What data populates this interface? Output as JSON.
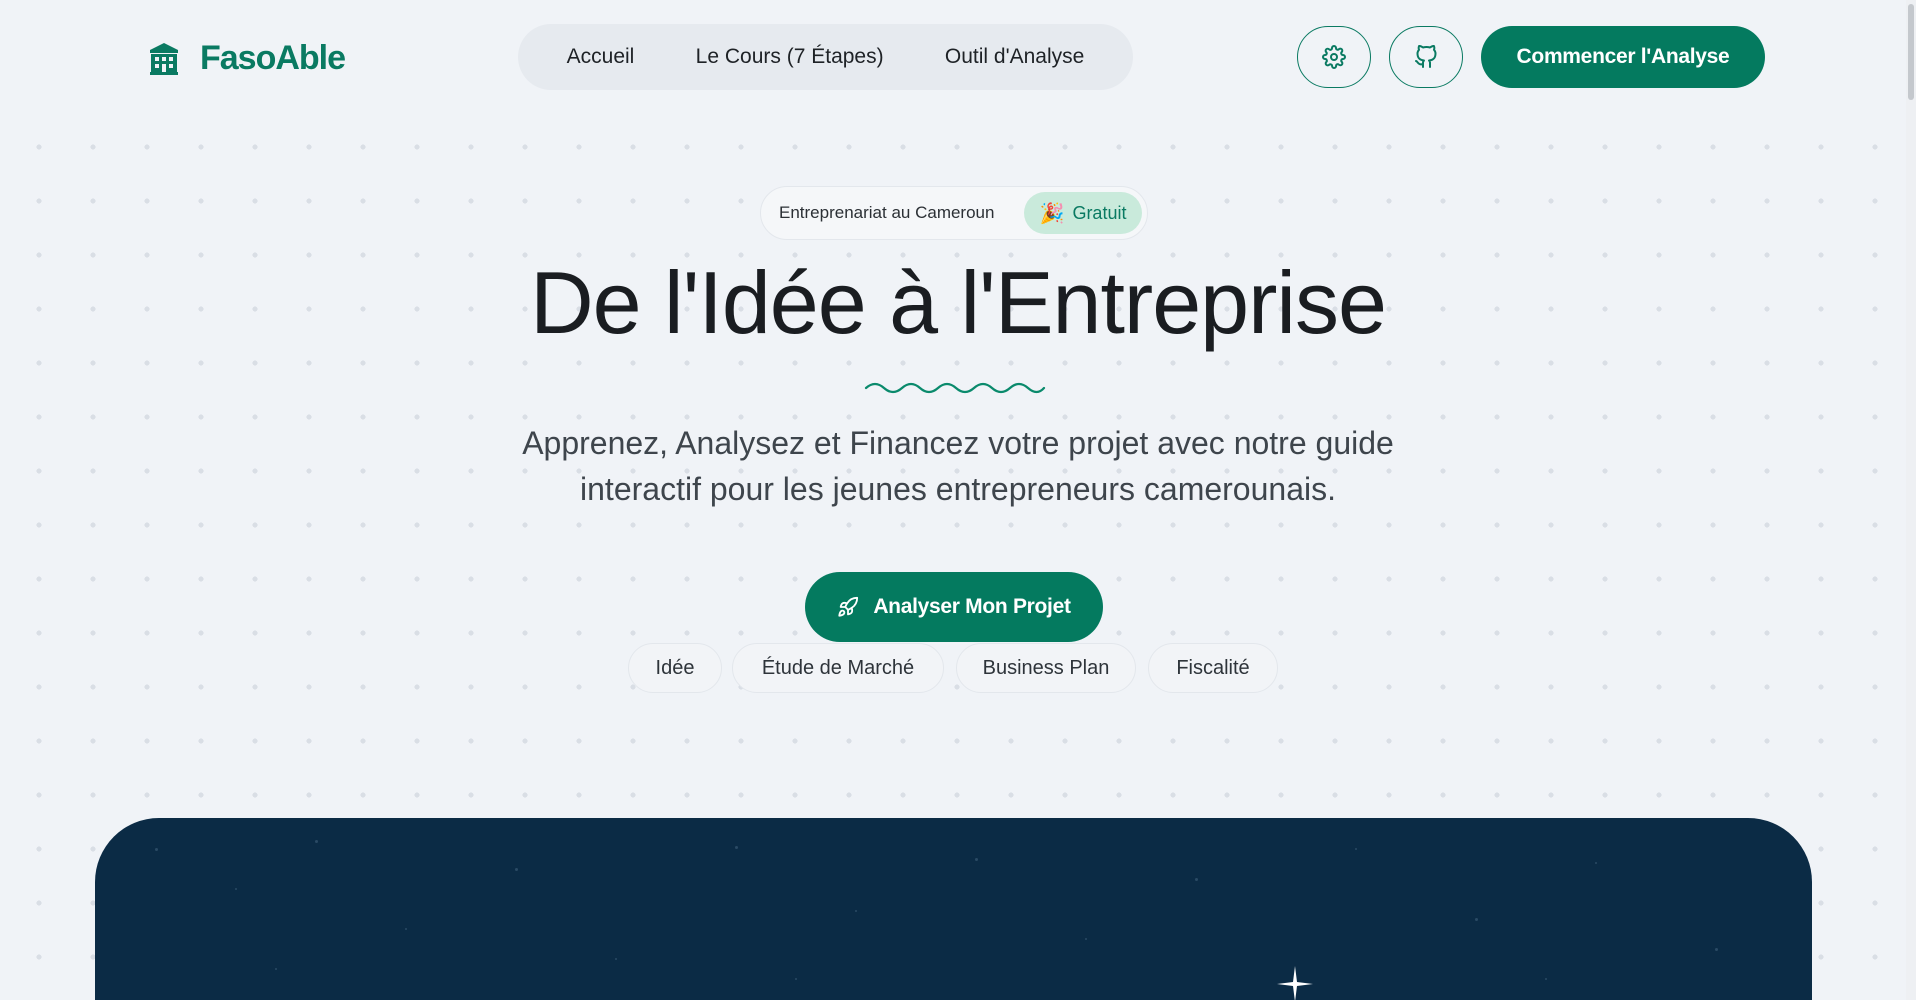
{
  "header": {
    "logo_text": "FasoAble",
    "logo_icon": "building-icon",
    "nav": [
      {
        "label": "Accueil"
      },
      {
        "label": "Le Cours (7 Étapes)"
      },
      {
        "label": "Outil d'Analyse"
      }
    ],
    "settings_icon": "gear-icon",
    "github_icon": "github-icon",
    "cta_label": "Commencer l'Analyse"
  },
  "hero": {
    "badge_text": "Entreprenariat au Cameroun",
    "badge_pill_emoji": "🎉",
    "badge_pill_label": "Gratuit",
    "title": "De l'Idée à l'Entreprise",
    "subtitle_line1": "Apprenez, Analysez et Financez votre projet avec notre guide",
    "subtitle_line2": "interactif pour les jeunes entrepreneurs camerounais.",
    "cta_label": "Analyser Mon Projet",
    "cta_icon": "rocket-icon",
    "chips": [
      {
        "label": "Idée"
      },
      {
        "label": "Étude de Marché"
      },
      {
        "label": "Business Plan"
      },
      {
        "label": "Fiscalité"
      }
    ]
  },
  "colors": {
    "brand": "#047a5f",
    "background": "#f0f3f7",
    "panel": "#0b2b45",
    "badge_pill": "#c9eadb"
  }
}
